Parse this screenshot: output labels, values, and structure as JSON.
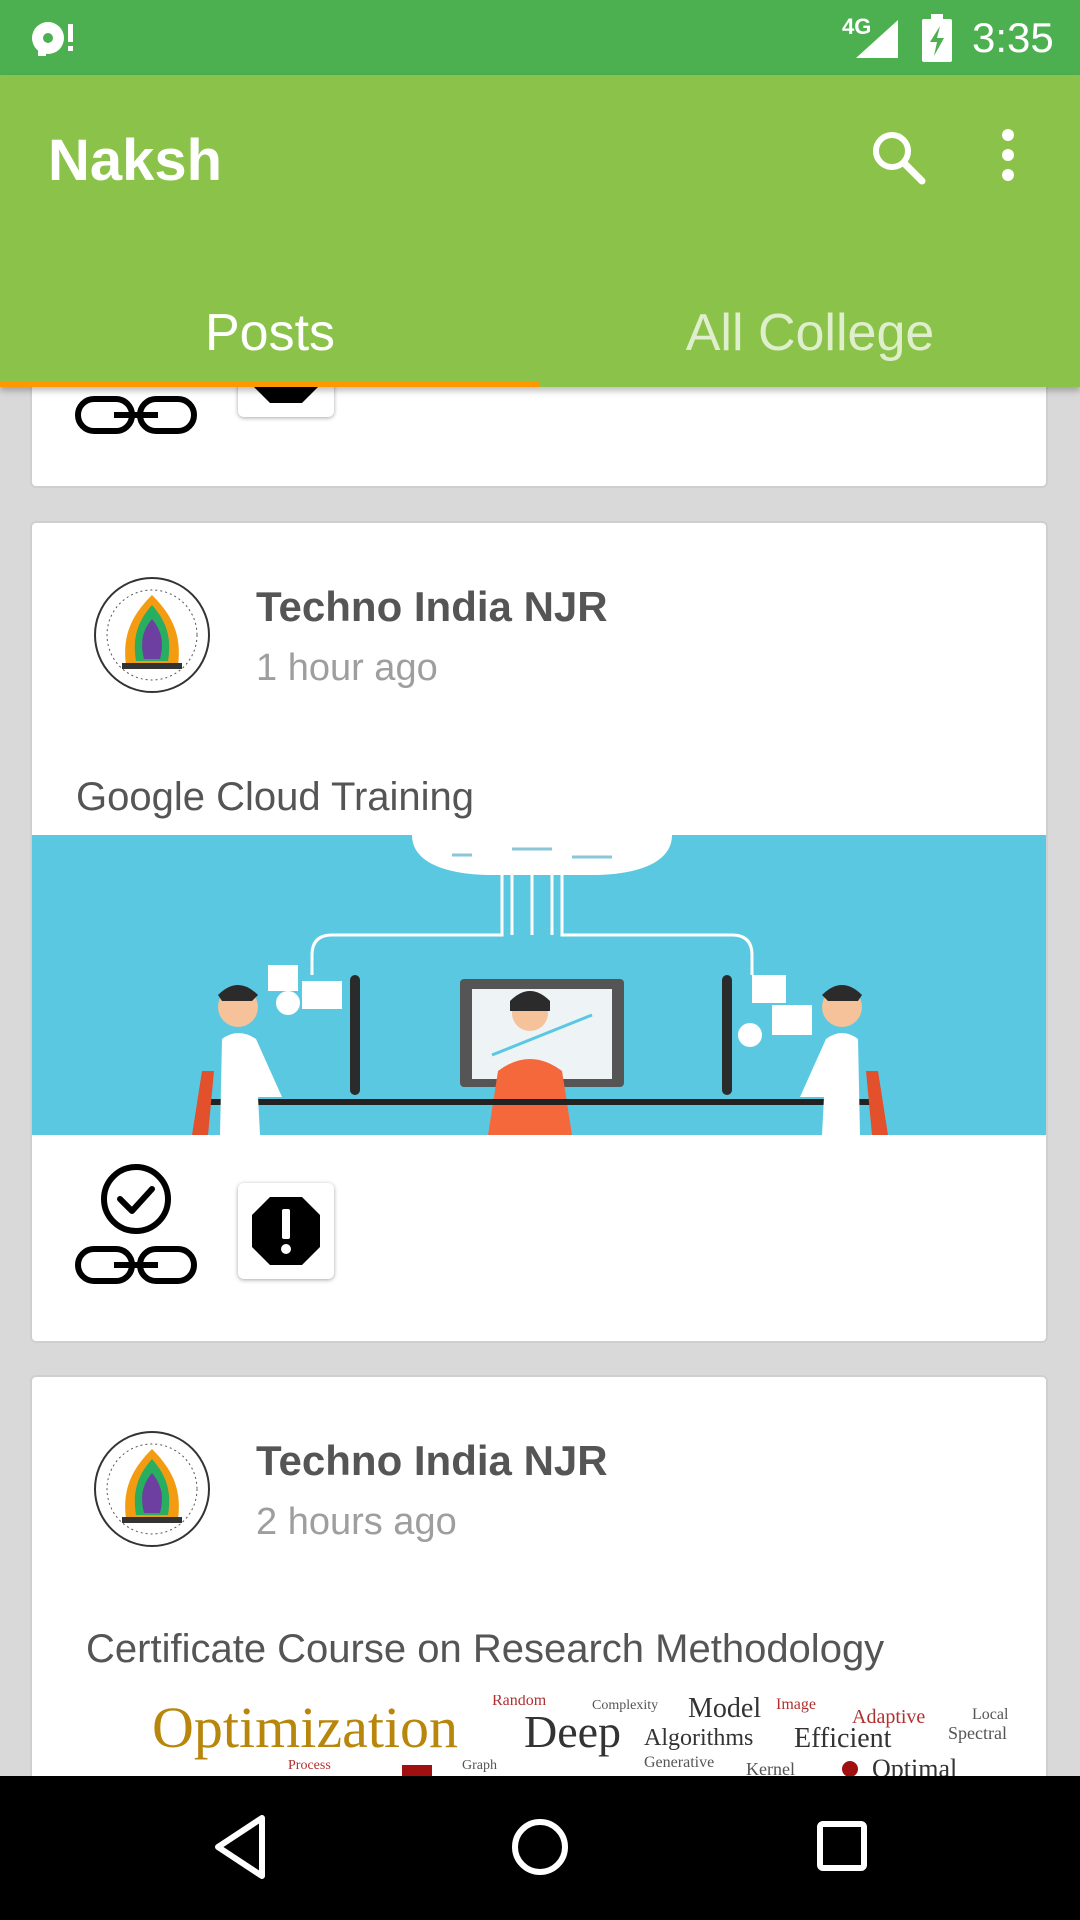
{
  "status_bar": {
    "network": "4G",
    "time": "3:35"
  },
  "app_bar": {
    "title": "Naksh"
  },
  "tabs": [
    {
      "label": "Posts",
      "active": true
    },
    {
      "label": "All College",
      "active": false
    }
  ],
  "colors": {
    "status_bar": "#4caf50",
    "app_bar": "#8bc34a",
    "tab_indicator": "#ff9800"
  },
  "posts": [
    {
      "author": "Techno India NJR",
      "time": "1 hour ago",
      "title": "Google Cloud Training"
    },
    {
      "author": "Techno India NJR",
      "time": "2 hours ago",
      "title": "Certificate Course on Research Methodology"
    }
  ],
  "wordcloud": {
    "words": [
      "Optimization",
      "Deep",
      "Model",
      "Algorithms",
      "Efficient",
      "Adaptive",
      "Random",
      "Complexity",
      "Image",
      "Spectral",
      "Local",
      "Generative",
      "Kernel",
      "Optimal",
      "Process",
      "Graph"
    ]
  }
}
